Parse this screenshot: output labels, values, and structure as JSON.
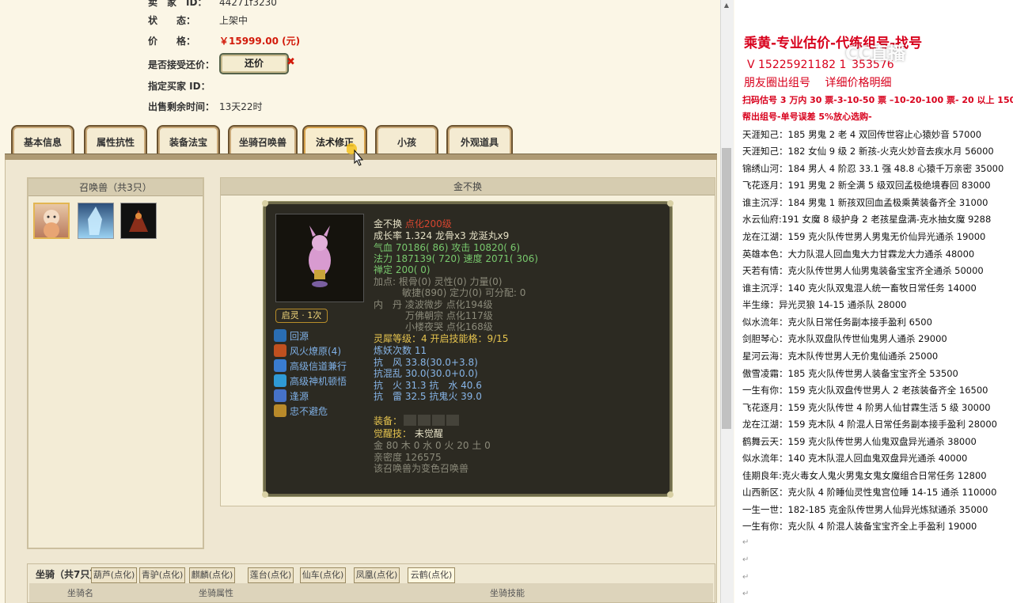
{
  "listing": {
    "seller_label": "卖　家　ID：",
    "seller_value": "44271f3230",
    "status_label": "状　　态：",
    "status_value": "上架中",
    "price_label": "价　　格：",
    "price_value": "￥15999.00 (元)",
    "counter_label": "是否接受还价：",
    "counter_button": "还价",
    "buyer_label": "指定买家 ID：",
    "buyer_value": "",
    "time_label": "出售剩余时间：",
    "time_value": "13天22时"
  },
  "tabs": [
    "基本信息",
    "属性抗性",
    "装备法宝",
    "坐骑召唤兽",
    "法术修正",
    "小孩",
    "外观道具"
  ],
  "pet_list": {
    "title": "召唤兽（共3只）"
  },
  "detail": {
    "title": "金不换",
    "name": "金不换",
    "name_tag": "点化200级",
    "growth": "成长率 1.324 龙骨x3 龙涎丸x9",
    "hp": "气血 70186( 86) 攻击 10820( 6)",
    "mp": "法力 187139( 720) 速度 2071( 306)",
    "zen": "禅定 200( 0)",
    "points1": "加点:  根骨(0) 灵性(0) 力量(0)",
    "points2": "敏捷(890) 定力(0) 可分配:  0",
    "neidan1": "内　丹 凌波微步 点化194级",
    "neidan2": "万佛朝宗 点化117级",
    "neidan3": "小楼夜哭 点化168级",
    "lingxi": "灵犀等级：4 开启技能格：9/15",
    "lianyao": "炼妖次数 11",
    "res1": "抗　风 33.8(30.0+3.8)",
    "res2": "抗混乱 30.0(30.0+0.0)",
    "res3": "抗　火 31.3 抗　水 40.6",
    "res4": "抗　雷 32.5 抗鬼火 39.0",
    "equip_label": "装备：",
    "awaken_label": "觉醒技：",
    "awaken_value": "未觉醒",
    "elements": "金 80 木 0 水 0 火 20 土 0",
    "intimacy": "亲密度 126575",
    "note": "该召唤兽为变色召唤兽",
    "qiling": "启灵 · 1次",
    "skills": [
      "回源",
      "风火燎原(4)",
      "高级信道兼行",
      "高级神机顿悟",
      "逢源",
      "忠不避危"
    ]
  },
  "mount": {
    "title": "坐骑（共7只）",
    "tabs": [
      "葫芦(点化)",
      "青驴(点化)",
      "麒麟(点化)",
      "莲台(点化)",
      "仙车(点化)",
      "凤凰(点化)",
      "云鹤(点化)"
    ],
    "col1": "坐骑名",
    "col2": "坐骑属性",
    "col3": "坐骑技能"
  },
  "ad": {
    "headline": "乘黄-专业估价-代练组号-找号",
    "phone": "V 15225921182  1   353576",
    "sub": "朋友圈出组号　 详细价格明细",
    "line1": "扫码估号 3 万内 30 票-3-10-50 票 –10-20-100 票- 20 以上 150",
    "line2": "帮出组号-单号误差 5%放心选购-",
    "logo": "CC直播",
    "listings": [
      "天涯知己：185 男鬼 2 老 4 双回传世容止心猿妙音 57000",
      "天涯知己：182 女仙 9 级 2 新孩-火克火妙音去疾水月 56000",
      "锦绣山河：184 男人 4 阶忍 33.1 强 48.8 心猿千万亲密 35000",
      "飞花逐月：191 男鬼 2 新全满 5 级双回孟极绝境春回 83000",
      "谁主沉浮：184 男鬼 1 新孩双回血孟极乘黄装备齐全 31000",
      "水云仙府:191 女魔 8 级护身 2 老孩星盘满-克水抽女魔 9288",
      "龙在江湖：159 克火队传世男人男鬼无价仙异光通杀 19000",
      "英雄本色：大力队混人回血鬼大力甘霖龙大力通杀 48000",
      "天若有情：克火队传世男人仙男鬼装备宝宝齐全通杀 50000",
      "谁主沉浮：140 克火队双鬼混人统一畜牧日常任务 14000",
      "半生缘：异光灵狼 14-15 通杀队 28000",
      "似水流年：克火队日常任务副本接手盈利 6500",
      "剑胆琴心：克水队双盘队传世仙鬼男人通杀 29000",
      "星河云海：克木队传世男人无价鬼仙通杀 25000",
      "傲雪凌霜：185 克火队传世男人装备宝宝齐全 53500",
      "一生有你：159 克火队双盘传世男人 2 老孩装备齐全 16500",
      "飞花逐月：159 克火队传世 4 阶男人仙甘霖生活 5 级 30000",
      "龙在江湖：159 克木队 4 阶混人日常任务副本接手盈利 28000",
      "鹤舞云天：159 克火队传世男人仙鬼双盘异光通杀 38000",
      "似水流年：140 克木队混人回血鬼双盘异光通杀 40000",
      "佳期良年:克火毒女人鬼火男鬼女鬼女魔组合日常任务 12800",
      "山西新区：克火队 4 阶睡仙灵性鬼宫位睡 14-15 通杀 110000",
      "一生一世：182-185 克金队传世男人仙异光炼狱通杀 35000",
      "一生有你：克火队 4 阶混人装备宝宝齐全上手盈利 19000"
    ]
  }
}
